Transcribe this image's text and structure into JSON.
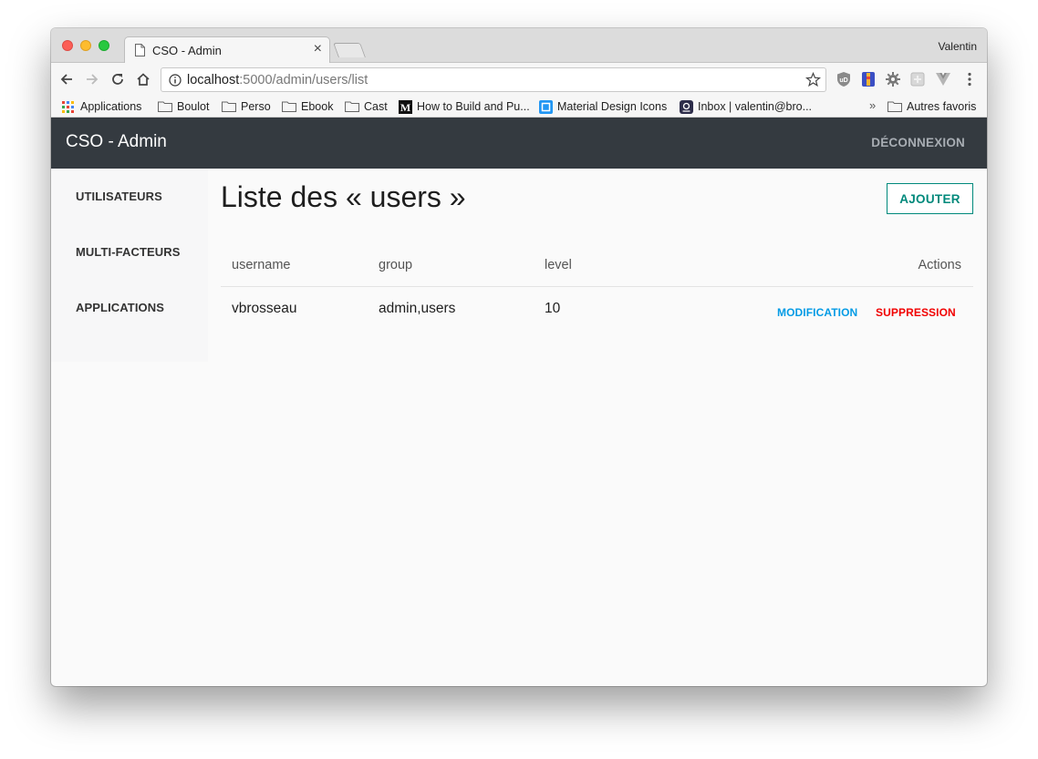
{
  "browser": {
    "tab_title": "CSO - Admin",
    "profile": "Valentin",
    "url_host": "localhost",
    "url_path": ":5000/admin/users/list",
    "bookmarks": [
      {
        "label": "Applications",
        "icon": "apps-grid-icon"
      },
      {
        "label": "Boulot",
        "icon": "folder-icon"
      },
      {
        "label": "Perso",
        "icon": "folder-icon"
      },
      {
        "label": "Ebook",
        "icon": "folder-icon"
      },
      {
        "label": "Cast",
        "icon": "folder-icon"
      },
      {
        "label": "How to Build and Pu...",
        "icon": "medium-icon"
      },
      {
        "label": "Material Design Icons",
        "icon": "material-icon"
      },
      {
        "label": "Inbox | valentin@bro...",
        "icon": "inbox-icon"
      }
    ],
    "bookmarks_more": "»",
    "other_bookmarks": "Autres favoris"
  },
  "app": {
    "brand": "CSO - Admin",
    "logout": "DÉCONNEXION",
    "nav": [
      "UTILISATEURS",
      "MULTI-FACTEURS",
      "APPLICATIONS"
    ],
    "page_title": "Liste des « users »",
    "add_button": "AJOUTER",
    "table": {
      "headers": [
        "username",
        "group",
        "level",
        "Actions"
      ],
      "rows": [
        {
          "username": "vbrosseau",
          "group": "admin,users",
          "level": "10",
          "edit": "MODIFICATION",
          "delete": "SUPPRESSION"
        }
      ]
    },
    "colors": {
      "header_bg": "#343a40",
      "accent": "#00897b",
      "edit": "#039be5",
      "delete": "#f10000"
    }
  }
}
